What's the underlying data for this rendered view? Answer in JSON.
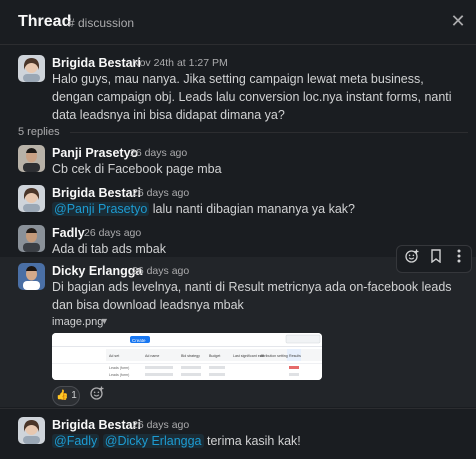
{
  "header": {
    "title": "Thread",
    "channel": "# discussion"
  },
  "root": {
    "author": "Brigida Bestari",
    "time": "Nov 24th at 1:27 PM",
    "text": "Halo guys, mau nanya. Jika setting campaign lewat meta business, dengan campaign obj. Leads lalu conversion loc.nya instant forms, nanti data leadsnya ini bisa didapat dimana ya?"
  },
  "replies_count": "5 replies",
  "replies": [
    {
      "author": "Panji Prasetyo",
      "time": "26 days ago",
      "text": "Cb cek di Facebook page mba"
    },
    {
      "author": "Brigida Bestari",
      "time": "26 days ago",
      "mention": "@Panji Prasetyo",
      "text": " lalu nanti dibagian mananya ya kak?"
    },
    {
      "author": "Fadly",
      "time": "26 days ago",
      "text": "Ada di tab ads mbak"
    },
    {
      "author": "Dicky Erlangga",
      "time": "26 days ago",
      "text": "Di bagian ads levelnya, nanti di Result metricnya ada on-facebook leads dan bisa download leadsnya mbak",
      "file_name": "image.png",
      "reaction_emoji": "👍",
      "reaction_count": "1"
    },
    {
      "author": "Brigida Bestari",
      "time": "26 days ago",
      "mention1": "@Fadly",
      "mention2": "@Dicky Erlangga",
      "text": " terima kasih kak!"
    }
  ],
  "thumbnail_text": {
    "create": "Create",
    "columns": [
      "Ad set",
      "Ad name",
      "Bid strategy",
      "Budget",
      "Last significant edit",
      "Attribution setting",
      "Results"
    ],
    "rows": [
      "Leads (form)",
      "Leads (form)"
    ]
  },
  "icons": [
    "close-icon",
    "add-reaction-icon",
    "bookmark-icon",
    "more-icon"
  ]
}
